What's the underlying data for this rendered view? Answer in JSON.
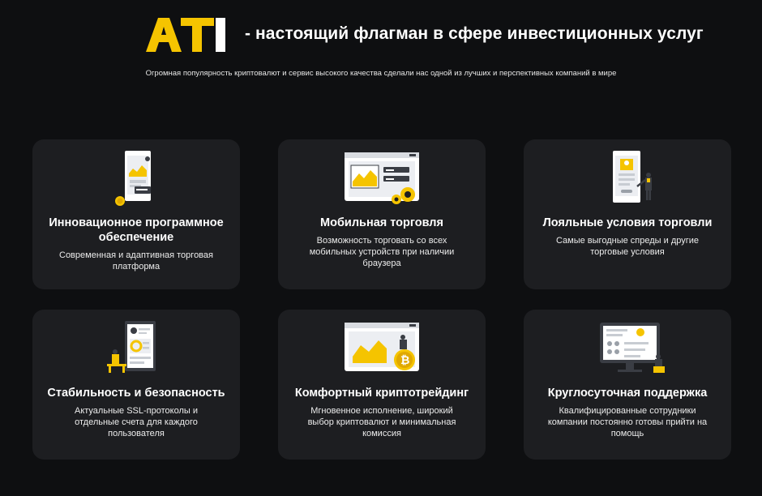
{
  "header": {
    "logo_text": "ATI",
    "headline": "- настоящий флагман в сфере инвестиционных услуг",
    "subline": "Огромная популярность криптовалют и сервис высокого качества сделали нас одной из лучших и перспективных компаний в мире"
  },
  "colors": {
    "background": "#0e0f11",
    "card": "#1d1e21",
    "accent": "#f5c400"
  },
  "features": [
    {
      "icon": "software-icon",
      "title": "Инновационное программное обеспечение",
      "desc": "Современная и адаптивная торговая платформа"
    },
    {
      "icon": "mobile-trading-icon",
      "title": "Мобильная торговля",
      "desc": "Возможность торговать со всех мобильных устройств при наличии браузера"
    },
    {
      "icon": "loyal-conditions-icon",
      "title": "Лояльные условия торговли",
      "desc": "Самые выгодные спреды и другие торговые условия"
    },
    {
      "icon": "security-icon",
      "title": "Стабильность и безопасность",
      "desc": "Актуальные SSL-протоколы и отдельные счета для каждого пользователя"
    },
    {
      "icon": "crypto-trading-icon",
      "title": "Комфортный криптотрейдинг",
      "desc": "Мгновенное исполнение, широкий выбор криптовалют и минимальная комиссия"
    },
    {
      "icon": "support-icon",
      "title": "Круглосуточная поддержка",
      "desc": "Квалифицированные сотрудники компании постоянно готовы прийти на помощь"
    }
  ]
}
